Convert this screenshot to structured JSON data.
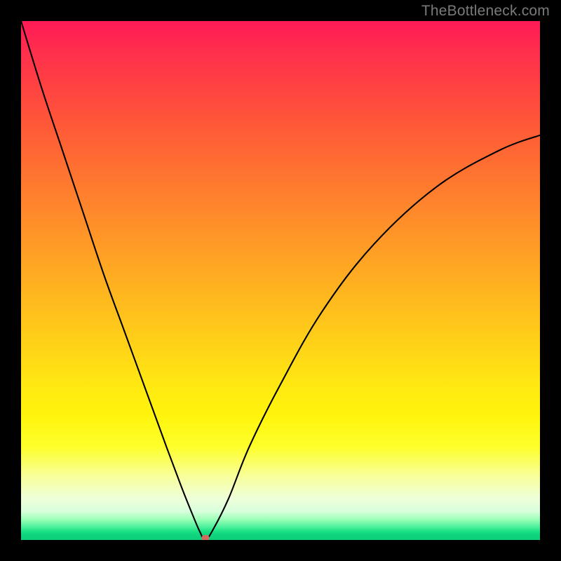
{
  "watermark": "TheBottleneck.com",
  "chart_data": {
    "type": "line",
    "title": "",
    "xlabel": "",
    "ylabel": "",
    "xlim": [
      0,
      100
    ],
    "ylim": [
      0,
      100
    ],
    "background": {
      "kind": "vertical-gradient",
      "stops": [
        {
          "pct": 0,
          "color": "#ff1a56"
        },
        {
          "pct": 22,
          "color": "#ff5e36"
        },
        {
          "pct": 46,
          "color": "#ffa324"
        },
        {
          "pct": 70,
          "color": "#ffe812"
        },
        {
          "pct": 88,
          "color": "#f8ffa0"
        },
        {
          "pct": 96,
          "color": "#9effb8"
        },
        {
          "pct": 100,
          "color": "#0ecf7a"
        }
      ]
    },
    "curve": {
      "description": "V-shaped bottleneck curve with minimum near x≈35",
      "x": [
        0,
        4,
        8,
        12,
        16,
        20,
        24,
        28,
        31,
        33,
        34.5,
        35.5,
        37,
        40,
        44,
        50,
        58,
        68,
        80,
        92,
        100
      ],
      "y": [
        100,
        87,
        75,
        63,
        51,
        40,
        29,
        18,
        10,
        5,
        1.5,
        0,
        2,
        8,
        18,
        30,
        44,
        57,
        68,
        75,
        78
      ]
    },
    "minimum_marker": {
      "x": 35.5,
      "y": 0,
      "color": "#d46a5f"
    },
    "colors": {
      "curve_stroke": "#000000"
    }
  }
}
